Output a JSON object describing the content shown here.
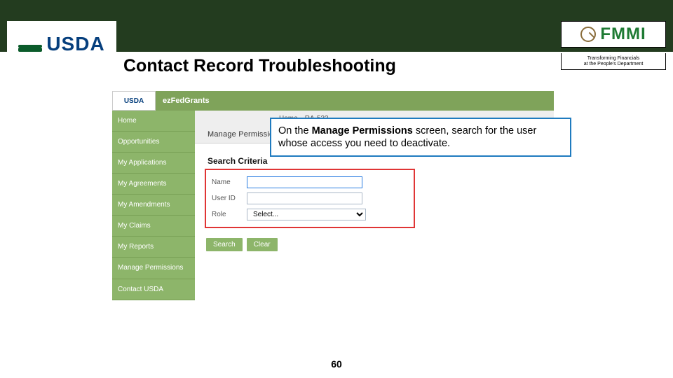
{
  "header": {
    "usda_label": "USDA",
    "title": "Contact Record Troubleshooting",
    "fmmi_label": "FMMI",
    "fmmi_tagline_line1": "Transforming Financials",
    "fmmi_tagline_line2": "at the People's Department"
  },
  "callout": {
    "prefix": "On the ",
    "bold1": "Manage Permissions",
    "mid": " screen, search for the user whose access you need to deactivate."
  },
  "app": {
    "brand_small": "USDA",
    "topbar_title": "ezFedGrants",
    "nav": [
      "Home",
      "Opportunities",
      "My Applications",
      "My Agreements",
      "My Amendments",
      "My Claims",
      "My Reports",
      "Manage Permissions",
      "Contact USDA"
    ],
    "tabs": {
      "home": "Home",
      "code": "RA-533"
    },
    "content_title": "Manage Permissions",
    "section_heading": "Search Criteria",
    "fields": {
      "name_label": "Name",
      "name_value": "",
      "userid_label": "User ID",
      "userid_value": "",
      "role_label": "Role",
      "role_selected": "Select..."
    },
    "buttons": {
      "search": "Search",
      "clear": "Clear"
    }
  },
  "page_number": "60"
}
